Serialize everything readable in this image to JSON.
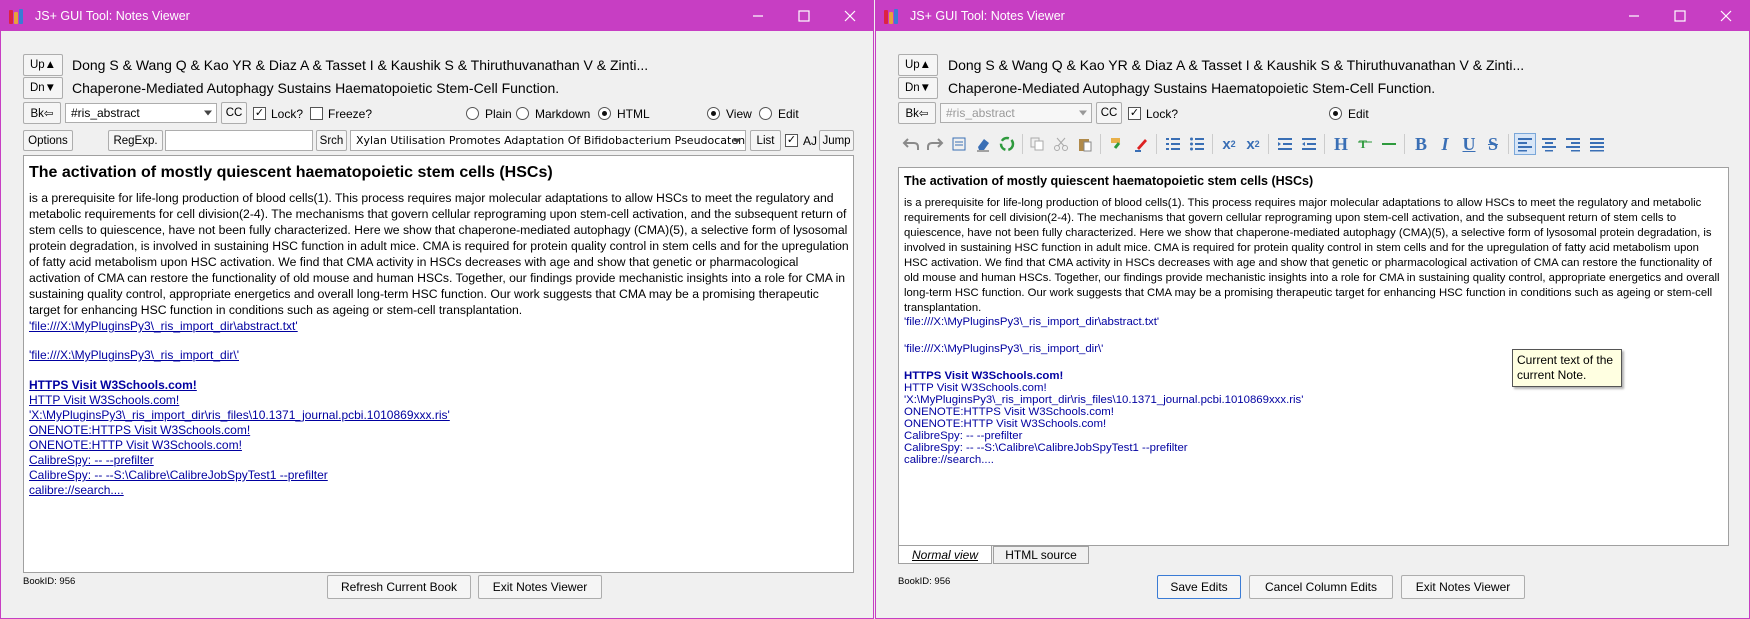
{
  "left": {
    "title": "JS+ GUI Tool:  Notes Viewer",
    "up_label": "Up▲",
    "dn_label": "Dn▼",
    "authors": "Dong S & Wang Q & Kao YR & Diaz A & Tasset I & Kaushik S & Thiruthuvanathan V & Zinti...",
    "article_title": "Chaperone-Mediated Autophagy Sustains Haematopoietic Stem-Cell Function.",
    "bk_label": "Bk⇦",
    "field_value": "#ris_abstract",
    "cc_label": "CC",
    "lock_label": "Lock?",
    "freeze_label": "Freeze?",
    "plain_label": "Plain",
    "markdown_label": "Markdown",
    "html_label": "HTML",
    "view_label": "View",
    "edit_label": "Edit",
    "options_label": "Options",
    "regexp_label": "RegExp.",
    "regexp_value": "",
    "srch_label": "Srch",
    "search_combo_value": "Xylan Utilisation Promotes Adaptation Of Bifidobacterium Pseudocatenulat...",
    "list_label": "List",
    "aj_label": "AJ",
    "jump_label": "Jump",
    "note": {
      "heading": "The activation of mostly quiescent haematopoietic stem cells (HSCs)",
      "body": "is a prerequisite for life-long production of blood cells(1). This process requires major molecular adaptations to allow HSCs to meet the regulatory and metabolic requirements for cell division(2-4). The mechanisms that govern cellular reprograming upon stem-cell activation, and the subsequent return of stem cells to quiescence, have not been fully characterized. Here we show that chaperone-mediated autophagy (CMA)(5), a selective form of lysosomal protein degradation, is involved in sustaining HSC function in adult mice. CMA is required for protein quality control in stem cells and for the upregulation of fatty acid metabolism upon HSC activation. We find that CMA activity in HSCs decreases with age and show that genetic or pharmacological activation of CMA can restore the functionality of old mouse and human HSCs. Together, our findings provide mechanistic insights into a role for CMA in sustaining quality control, appropriate energetics and overall long-term HSC function. Our work suggests that CMA may be a promising therapeutic target for enhancing HSC function in conditions such as ageing or stem-cell transplantation.",
      "link1": "'file:///X:\\MyPluginsPy3\\_ris_import_dir\\abstract.txt'",
      "link2": "'file:///X:\\MyPluginsPy3\\_ris_import_dir\\'",
      "link3": "HTTPS Visit W3Schools.com!",
      "link4": "HTTP Visit W3Schools.com!",
      "link5": "'X:\\MyPluginsPy3\\_ris_import_dir\\ris_files\\10.1371_journal.pcbi.1010869xxx.ris'",
      "link6": "ONENOTE:HTTPS Visit W3Schools.com!",
      "link7": "ONENOTE:HTTP Visit W3Schools.com!",
      "link8": "CalibreSpy: -- --prefilter",
      "link9": "CalibreSpy: -- --S:\\Calibre\\CalibreJobSpyTest1 --prefilter",
      "link10": "calibre://search...."
    },
    "bookid": "BookID: 956",
    "refresh_label": "Refresh Current Book",
    "exit_label": "Exit Notes Viewer"
  },
  "right": {
    "title": "JS+ GUI Tool:  Notes Viewer",
    "up_label": "Up▲",
    "dn_label": "Dn▼",
    "authors": "Dong S & Wang Q & Kao YR & Diaz A & Tasset I & Kaushik S & Thiruthuvanathan V & Zinti...",
    "article_title": "Chaperone-Mediated Autophagy Sustains Haematopoietic Stem-Cell Function.",
    "bk_label": "Bk⇦",
    "field_value": "#ris_abstract",
    "cc_label": "CC",
    "lock_label": "Lock?",
    "edit_label": "Edit",
    "tooltip": "Current text of the current Note.",
    "tab_normal": "Normal view",
    "tab_html": "HTML source",
    "bookid": "BookID: 956",
    "save_label": "Save Edits",
    "cancel_label": "Cancel Column Edits",
    "exit_label": "Exit Notes Viewer"
  }
}
